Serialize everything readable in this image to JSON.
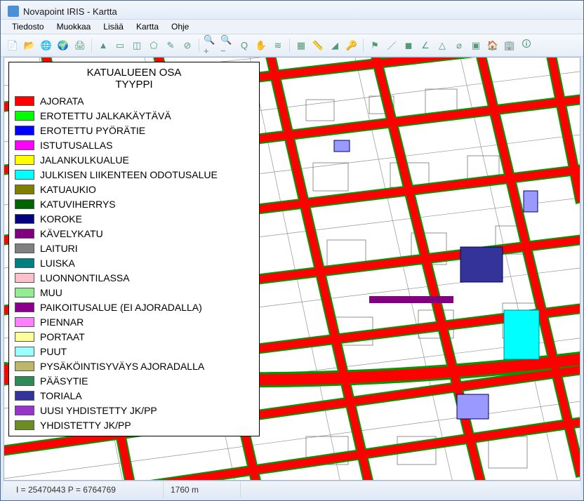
{
  "window": {
    "title": "Novapoint IRIS - Kartta"
  },
  "menu": {
    "items": [
      "Tiedosto",
      "Muokkaa",
      "Lisää",
      "Kartta",
      "Ohje"
    ]
  },
  "toolbar": {
    "buttons": [
      {
        "name": "new-icon",
        "glyph": "📄"
      },
      {
        "name": "open-icon",
        "glyph": "📂"
      },
      {
        "name": "globe-open-icon",
        "glyph": "🌐"
      },
      {
        "name": "globe-save-icon",
        "glyph": "🌍"
      },
      {
        "name": "print-icon",
        "glyph": "🖨"
      },
      {
        "name": "sep"
      },
      {
        "name": "pointer-icon",
        "glyph": "▲"
      },
      {
        "name": "select-rect-icon",
        "glyph": "▭"
      },
      {
        "name": "select-fence-icon",
        "glyph": "◫"
      },
      {
        "name": "select-polygon-icon",
        "glyph": "⬠"
      },
      {
        "name": "select-freehand-icon",
        "glyph": "✎"
      },
      {
        "name": "no-entry-icon",
        "glyph": "⊘"
      },
      {
        "name": "sep"
      },
      {
        "name": "zoom-in-icon",
        "glyph": "🔍+"
      },
      {
        "name": "zoom-out-icon",
        "glyph": "🔍−"
      },
      {
        "name": "zoom-reset-icon",
        "glyph": "Q"
      },
      {
        "name": "pan-icon",
        "glyph": "✋"
      },
      {
        "name": "layers-icon",
        "glyph": "≋"
      },
      {
        "name": "sep"
      },
      {
        "name": "grid-icon",
        "glyph": "▦"
      },
      {
        "name": "ruler-icon",
        "glyph": "📏"
      },
      {
        "name": "measure-area-icon",
        "glyph": "◢"
      },
      {
        "name": "link-icon",
        "glyph": "🔑"
      },
      {
        "name": "sep"
      },
      {
        "name": "flag-icon",
        "glyph": "⚑"
      },
      {
        "name": "line-icon",
        "glyph": "／"
      },
      {
        "name": "region-icon",
        "glyph": "◼"
      },
      {
        "name": "angle-icon",
        "glyph": "∠"
      },
      {
        "name": "survey-tool-icon",
        "glyph": "△"
      },
      {
        "name": "profile-icon",
        "glyph": "⌀"
      },
      {
        "name": "section-icon",
        "glyph": "▣"
      },
      {
        "name": "house-icon",
        "glyph": "🏠"
      },
      {
        "name": "buildings-icon",
        "glyph": "🏢"
      },
      {
        "name": "info-icon",
        "glyph": "🛈"
      }
    ]
  },
  "legend": {
    "title_line1": "KATUALUEEN OSA",
    "title_line2": "TYYPPI",
    "items": [
      {
        "label": "AJORATA",
        "color": "#ff0000"
      },
      {
        "label": "EROTETTU JALKAKÄYTÄVÄ",
        "color": "#00ff00"
      },
      {
        "label": "EROTETTU PYÖRÄTIE",
        "color": "#0000ff"
      },
      {
        "label": "ISTUTUSALLAS",
        "color": "#ff00ff"
      },
      {
        "label": "JALANKULKUALUE",
        "color": "#ffff00"
      },
      {
        "label": "JULKISEN LIIKENTEEN ODOTUSALUE",
        "color": "#00ffff"
      },
      {
        "label": "KATUAUKIO",
        "color": "#808000"
      },
      {
        "label": "KATUVIHERRYS",
        "color": "#006400"
      },
      {
        "label": "KOROKE",
        "color": "#000080"
      },
      {
        "label": "KÄVELYKATU",
        "color": "#800080"
      },
      {
        "label": "LAITURI",
        "color": "#808080"
      },
      {
        "label": "LUISKA",
        "color": "#008080"
      },
      {
        "label": "LUONNONTILASSA",
        "color": "#ffc0cb"
      },
      {
        "label": "MUU",
        "color": "#90ee90"
      },
      {
        "label": "PAIKOITUSALUE (EI AJORADALLA)",
        "color": "#8b008b"
      },
      {
        "label": "PIENNAR",
        "color": "#ff80ff"
      },
      {
        "label": "PORTAAT",
        "color": "#ffff99"
      },
      {
        "label": "PUUT",
        "color": "#99ffff"
      },
      {
        "label": "PYSÄKÖINTISYVÄYS AJORADALLA",
        "color": "#bdb76b"
      },
      {
        "label": "PÄÄSYTIE",
        "color": "#2e8b57"
      },
      {
        "label": "TORIALA",
        "color": "#333399"
      },
      {
        "label": "UUSI YHDISTETTY JK/PP",
        "color": "#9933cc"
      },
      {
        "label": "YHDISTETTY JK/PP",
        "color": "#6b8e23"
      }
    ]
  },
  "status": {
    "coords": "I = 25470443  P = 6764769",
    "scale": "1760 m"
  }
}
